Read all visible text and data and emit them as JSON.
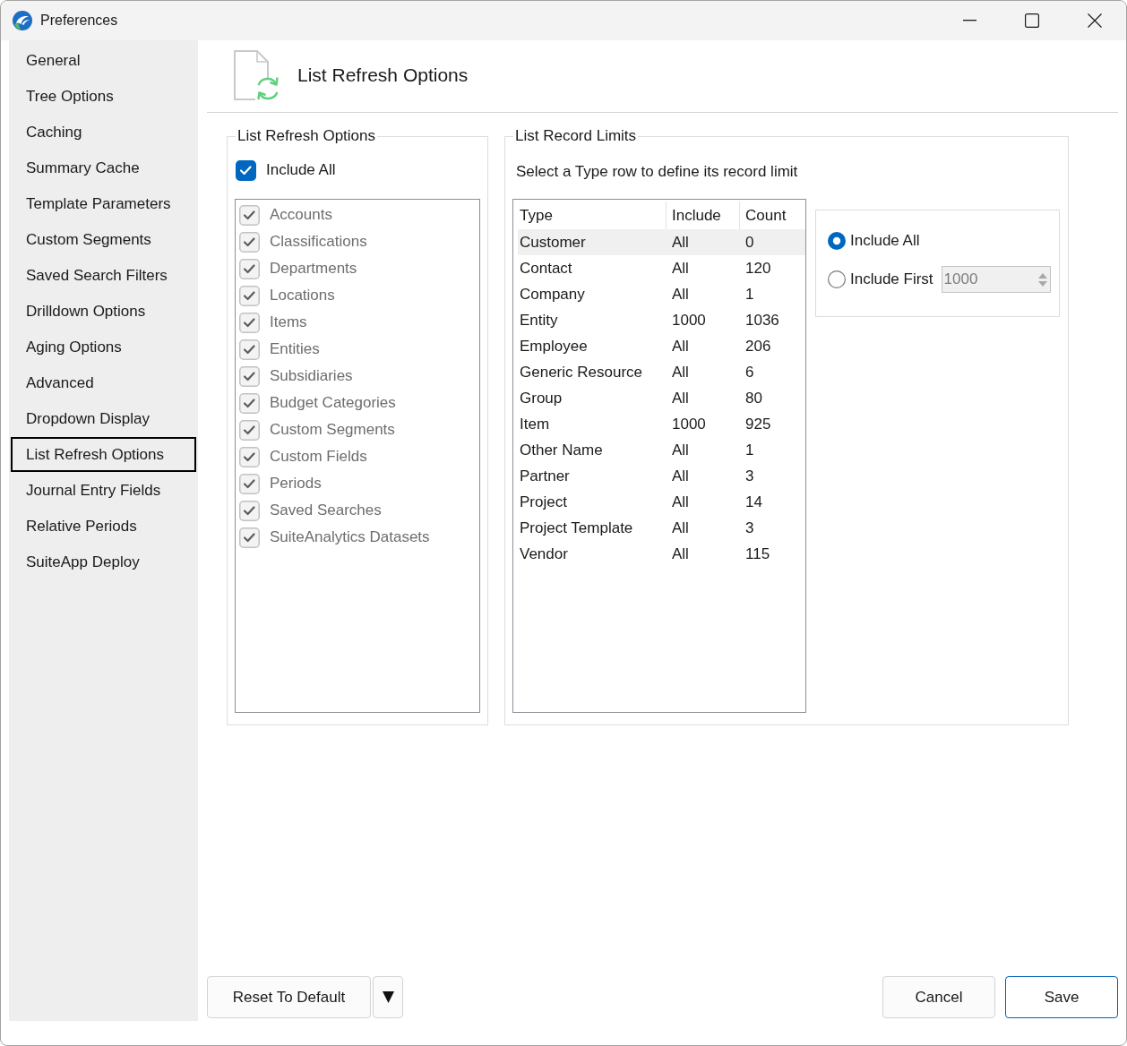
{
  "window": {
    "title": "Preferences"
  },
  "sidebar": {
    "items": [
      {
        "label": "General",
        "selected": false
      },
      {
        "label": "Tree Options",
        "selected": false
      },
      {
        "label": "Caching",
        "selected": false
      },
      {
        "label": "Summary Cache",
        "selected": false
      },
      {
        "label": "Template Parameters",
        "selected": false
      },
      {
        "label": "Custom Segments",
        "selected": false
      },
      {
        "label": "Saved Search Filters",
        "selected": false
      },
      {
        "label": "Drilldown Options",
        "selected": false
      },
      {
        "label": "Aging Options",
        "selected": false
      },
      {
        "label": "Advanced",
        "selected": false
      },
      {
        "label": "Dropdown Display",
        "selected": false
      },
      {
        "label": "List Refresh Options",
        "selected": true
      },
      {
        "label": "Journal Entry Fields",
        "selected": false
      },
      {
        "label": "Relative Periods",
        "selected": false
      },
      {
        "label": "SuiteApp Deploy",
        "selected": false
      }
    ]
  },
  "page_header": {
    "title": "List Refresh Options"
  },
  "refresh_options": {
    "legend": "List Refresh Options",
    "include_all": {
      "label": "Include All",
      "checked": true
    },
    "items": [
      {
        "label": "Accounts",
        "checked": true,
        "disabled": true
      },
      {
        "label": "Classifications",
        "checked": true,
        "disabled": true
      },
      {
        "label": "Departments",
        "checked": true,
        "disabled": true
      },
      {
        "label": "Locations",
        "checked": true,
        "disabled": true
      },
      {
        "label": "Items",
        "checked": true,
        "disabled": true
      },
      {
        "label": "Entities",
        "checked": true,
        "disabled": true
      },
      {
        "label": "Subsidiaries",
        "checked": true,
        "disabled": true
      },
      {
        "label": "Budget Categories",
        "checked": true,
        "disabled": true
      },
      {
        "label": "Custom Segments",
        "checked": true,
        "disabled": true
      },
      {
        "label": "Custom Fields",
        "checked": true,
        "disabled": true
      },
      {
        "label": "Periods",
        "checked": true,
        "disabled": true
      },
      {
        "label": "Saved Searches",
        "checked": true,
        "disabled": true
      },
      {
        "label": "SuiteAnalytics Datasets",
        "checked": true,
        "disabled": true
      }
    ]
  },
  "record_limits": {
    "legend": "List Record Limits",
    "hint": "Select a Type row to define its record limit",
    "table": {
      "columns": [
        "Type",
        "Include",
        "Count"
      ],
      "rows": [
        {
          "cells": [
            "Customer",
            "All",
            "0"
          ],
          "selected": true
        },
        {
          "cells": [
            "Contact",
            "All",
            "120"
          ],
          "selected": false
        },
        {
          "cells": [
            "Company",
            "All",
            "1"
          ],
          "selected": false
        },
        {
          "cells": [
            "Entity",
            "1000",
            "1036"
          ],
          "selected": false
        },
        {
          "cells": [
            "Employee",
            "All",
            "206"
          ],
          "selected": false
        },
        {
          "cells": [
            "Generic Resource",
            "All",
            "6"
          ],
          "selected": false
        },
        {
          "cells": [
            "Group",
            "All",
            "80"
          ],
          "selected": false
        },
        {
          "cells": [
            "Item",
            "1000",
            "925"
          ],
          "selected": false
        },
        {
          "cells": [
            "Other Name",
            "All",
            "1"
          ],
          "selected": false
        },
        {
          "cells": [
            "Partner",
            "All",
            "3"
          ],
          "selected": false
        },
        {
          "cells": [
            "Project",
            "All",
            "14"
          ],
          "selected": false
        },
        {
          "cells": [
            "Project Template",
            "All",
            "3"
          ],
          "selected": false
        },
        {
          "cells": [
            "Vendor",
            "All",
            "115"
          ],
          "selected": false
        }
      ]
    },
    "limit_options": [
      {
        "label": "Include All",
        "selected": true
      },
      {
        "label": "Include First",
        "selected": false
      }
    ],
    "limit_field": {
      "value": "1000",
      "disabled": true
    }
  },
  "footer": {
    "left_buttons": [
      {
        "label": "Reset To Default",
        "default": false
      }
    ],
    "right_buttons": [
      {
        "label": "Cancel",
        "default": false
      },
      {
        "label": "Save",
        "default": true
      }
    ]
  }
}
